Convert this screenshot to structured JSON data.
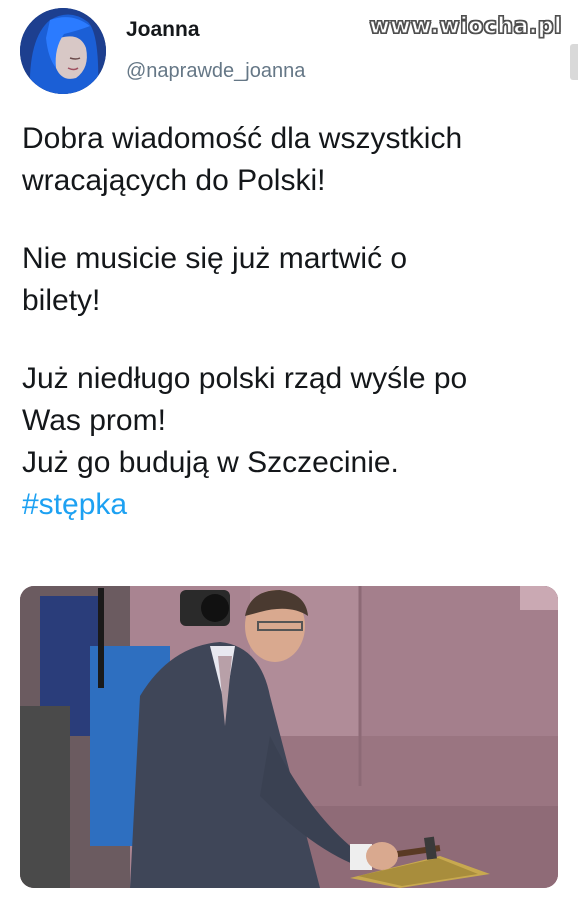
{
  "user": {
    "display_name": "Joanna",
    "handle": "@naprawde_joanna"
  },
  "watermark": "www.wiocha.pl",
  "tweet": {
    "paragraphs": [
      [
        "Dobra wiadomość dla wszystkich",
        "wracających do Polski!"
      ],
      [
        "Nie musicie się już martwić o",
        "bilety!"
      ],
      [
        "Już niedługo polski rząd wyśle po",
        "Was prom!",
        "Już go budują w Szczecinie."
      ]
    ],
    "hashtag": "#stępka"
  },
  "colors": {
    "hashtag": "#1da1f2",
    "handle": "#657786",
    "text": "#14171a",
    "background": "#ffffff"
  },
  "media": {
    "kind": "photo",
    "icon": "photo-icon"
  }
}
